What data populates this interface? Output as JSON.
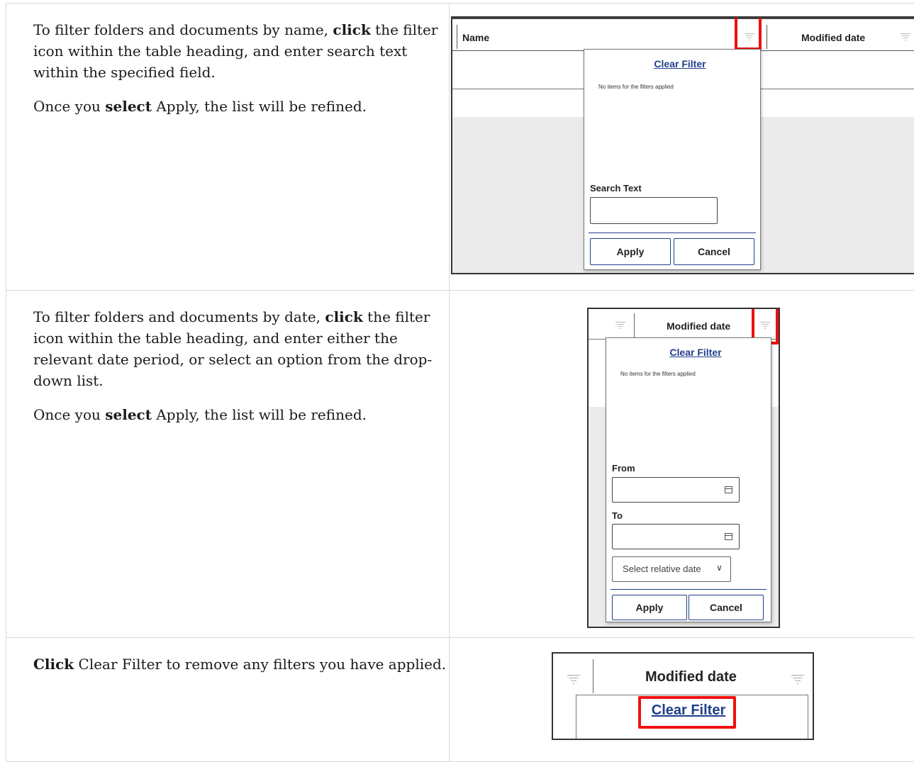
{
  "rows": [
    {
      "instructions": {
        "p1_before": "To filter folders and documents by name, ",
        "p1_bold": "click",
        "p1_after": " the filter icon within the table heading, and enter search text within the specified field.",
        "p2_before": "Once you ",
        "p2_bold": "select",
        "p2_after": " Apply, the list will be refined."
      },
      "screenshot": {
        "col_name": "Name",
        "col_modified": "Modified date",
        "clear_filter": "Clear Filter",
        "no_items": "No items for the filters applied",
        "search_label": "Search Text",
        "search_value": "",
        "apply": "Apply",
        "cancel": "Cancel"
      }
    },
    {
      "instructions": {
        "p1_before": "To filter folders and documents by date, ",
        "p1_bold": "click",
        "p1_after": " the filter icon within the table heading, and enter either the relevant date period, or select an option from the drop-down list.",
        "p2_before": "Once you ",
        "p2_bold": "select",
        "p2_after": " Apply, the list will be refined."
      },
      "screenshot": {
        "col_modified": "Modified date",
        "clear_filter": "Clear Filter",
        "no_items": "No items for the filters applied",
        "from_label": "From",
        "to_label": "To",
        "from_value": "",
        "to_value": "",
        "relative_date": "Select relative date",
        "apply": "Apply",
        "cancel": "Cancel"
      }
    },
    {
      "instructions": {
        "p1_bold": "Click",
        "p1_after": " Clear Filter to remove any filters you have applied."
      },
      "screenshot": {
        "col_modified": "Modified date",
        "clear_filter": "Clear Filter"
      }
    }
  ],
  "colors": {
    "highlight": "#ee1111",
    "link": "#1f3f8a",
    "border": "#d9d9d9"
  },
  "icons": [
    "filter-icon",
    "calendar-icon",
    "chevron-down-icon"
  ]
}
